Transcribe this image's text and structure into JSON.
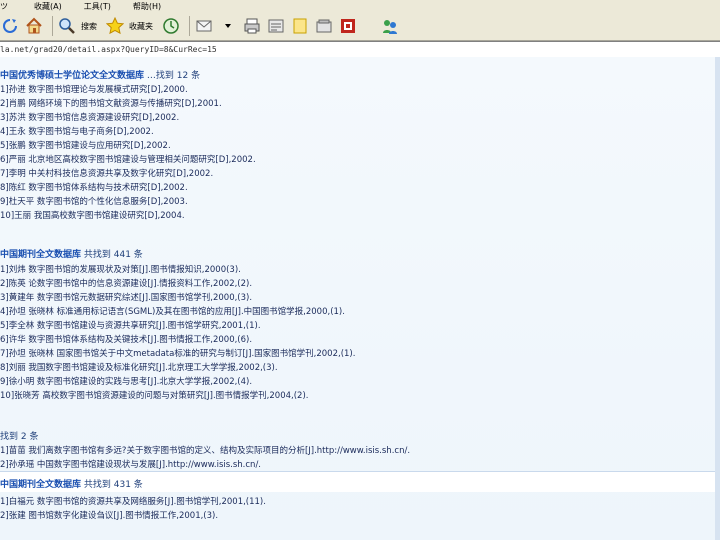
{
  "menu": {
    "items": [
      "ツ",
      "收藏(A)",
      "工具(T)",
      "帮助(H)"
    ]
  },
  "toolbar": {
    "search_label": "搜索",
    "favorites_label": "收藏夹"
  },
  "address": {
    "url": "la.net/grad20/detail.aspx?QueryID=8&CurRec=15"
  },
  "sections": [
    {
      "title_prefix": "中国优秀博硕士学位论文全文数据库",
      "title_suffix": "…找到 12 条",
      "items": [
        "1]孙进 数字图书馆理论与发展模式研究[D],2000.",
        "2]肖鹏 网络环境下的图书馆文献资源与传播研究[D],2001.",
        "3]苏洪 数字图书馆信息资源建设研究[D],2002.",
        "4]王永 数字图书馆与电子商务[D],2002.",
        "5]张鹏 数字图书馆建设与应用研究[D],2002.",
        "6]严丽 北京地区高校数字图书馆建设与管理相关问题研究[D],2002.",
        "7]李明 中关村科技信息资源共享及数字化研究[D],2002.",
        "8]陈红 数字图书馆体系结构与技术研究[D],2002.",
        "9]杜天平 数字图书馆的个性化信息服务[D],2003.",
        "10]王丽 我国高校数字图书馆建设研究[D],2004."
      ]
    },
    {
      "title_prefix": "中国期刊全文数据库",
      "title_suffix": "共找到 441 条",
      "items": [
        "1]刘炜 数字图书馆的发展现状及对策[J].图书情报知识,2000(3).",
        "2]陈英 论数字图书馆中的信息资源建设[J].情报资料工作,2002,(2).",
        "3]黄建年 数字图书馆元数据研究综述[J].国家图书馆学刊,2000,(3).",
        "4]孙坦 张晓林 标准通用标记语言(SGML)及其在图书馆的应用[J].中国图书馆学报,2000,(1).",
        "5]李全林 数字图书馆建设与资源共享研究[J].图书馆学研究,2001,(1).",
        "6]许华 数字图书馆体系结构及关键技术[J].图书情报工作,2000,(6).",
        "7]孙坦 张晓林 国家图书馆关于中文metadata标准的研究与制订[J].国家图书馆学刊,2002,(1).",
        "8]刘丽 我国数字图书馆建设及标准化研究[J].北京理工大学学报,2002,(3).",
        "9]徐小明 数字图书馆建设的实践与思考[J].北京大学学报,2002,(4).",
        "10]张晓芳 高校数字图书馆资源建设的问题与对策研究[J].图书情报学刊,2004,(2)."
      ]
    },
    {
      "title_prefix": "",
      "title_suffix": "找到 2 条",
      "items": [
        "1]苗苗 我们离数字图书馆有多远?关于数字图书馆的定义、结构及实际项目的分析[J].http://www.isis.sh.cn/.",
        "2]孙承瑶 中国数字图书馆建设现状与发展[J].http://www.isis.sh.cn/."
      ]
    },
    {
      "title_prefix": "中国期刊全文数据库",
      "title_suffix": "共找到 431 条",
      "items": [
        "1]白福元 数字图书馆的资源共享及网络服务[J].图书馆学刊,2001,(11).",
        "2]张建 图书馆数字化建设刍议[J].图书情报工作,2001,(3)."
      ]
    }
  ],
  "colors": {
    "menubar_bg": "#ece9d8",
    "content_bg": "#f4f9fd",
    "title_blue": "#1a4fb0",
    "text_navy": "#1a2a5a"
  }
}
